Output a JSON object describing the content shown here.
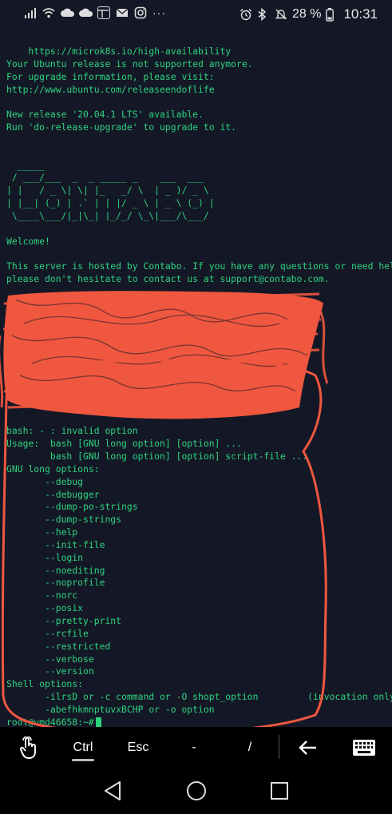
{
  "status_bar": {
    "battery_percent": "28 %",
    "time": "10:31",
    "overflow": "···",
    "left_icons": [
      "signal-icon",
      "wifi-icon",
      "cloud-icon",
      "cloud-icon",
      "browser-icon",
      "mail-icon",
      "instagram-icon"
    ],
    "right_icons": [
      "alarm-icon",
      "bluetooth-icon",
      "mute-icon",
      "battery-icon"
    ]
  },
  "terminal": {
    "lines": [
      "    https://microk8s.io/high-availability",
      "Your Ubuntu release is not supported anymore.",
      "For upgrade information, please visit:",
      "http://www.ubuntu.com/releaseendoflife",
      "",
      "New release '20.04.1 LTS' available.",
      "Run 'do-release-upgrade' to upgrade to it.",
      "",
      "",
      "  _____",
      " / ___/___  _  _ _____ _    ___  ___",
      "| |   / _ \\| \\| |_   _/ \\  | _ )/ _ \\",
      "| |__| (_) | .` | | |/ _ \\ | _ \\ (_) |",
      " \\____\\___/|_|\\_| |_/_/ \\_\\|___/\\___/",
      "",
      "Welcome!",
      "",
      "This server is hosted by Contabo. If you have any questions or need help,",
      "please don't hesitate to contact us at support@contabo.com.",
      "",
      "",
      "",
      "",
      "",
      "",
      "",
      "",
      "",
      "",
      "",
      "bash: - : invalid option",
      "Usage:  bash [GNU long option] [option] ...",
      "        bash [GNU long option] [option] script-file ...",
      "GNU long options:",
      "       --debug",
      "       --debugger",
      "       --dump-po-strings",
      "       --dump-strings",
      "       --help",
      "       --init-file",
      "       --login",
      "       --noediting",
      "       --noprofile",
      "       --norc",
      "       --posix",
      "       --pretty-print",
      "       --rcfile",
      "       --restricted",
      "       --verbose",
      "       --version",
      "Shell options:",
      "       -ilrsD or -c command or -O shopt_option         (invocation only)",
      "       -abefhkmnptuvxBCHP or -o option"
    ],
    "prompt": "root@vmd46658:~# "
  },
  "extra_keys": {
    "touch": "touch-icon",
    "ctrl": "Ctrl",
    "esc": "Esc",
    "dash": "-",
    "slash": "/",
    "back": "back-arrow-icon",
    "keyboard": "keyboard-icon"
  },
  "nav_bar": {
    "buttons": [
      "back-icon",
      "home-icon",
      "recents-icon"
    ]
  },
  "colors": {
    "terminal_bg": "#141826",
    "terminal_fg": "#2ed37e",
    "annotation_red": "#f0573f"
  }
}
